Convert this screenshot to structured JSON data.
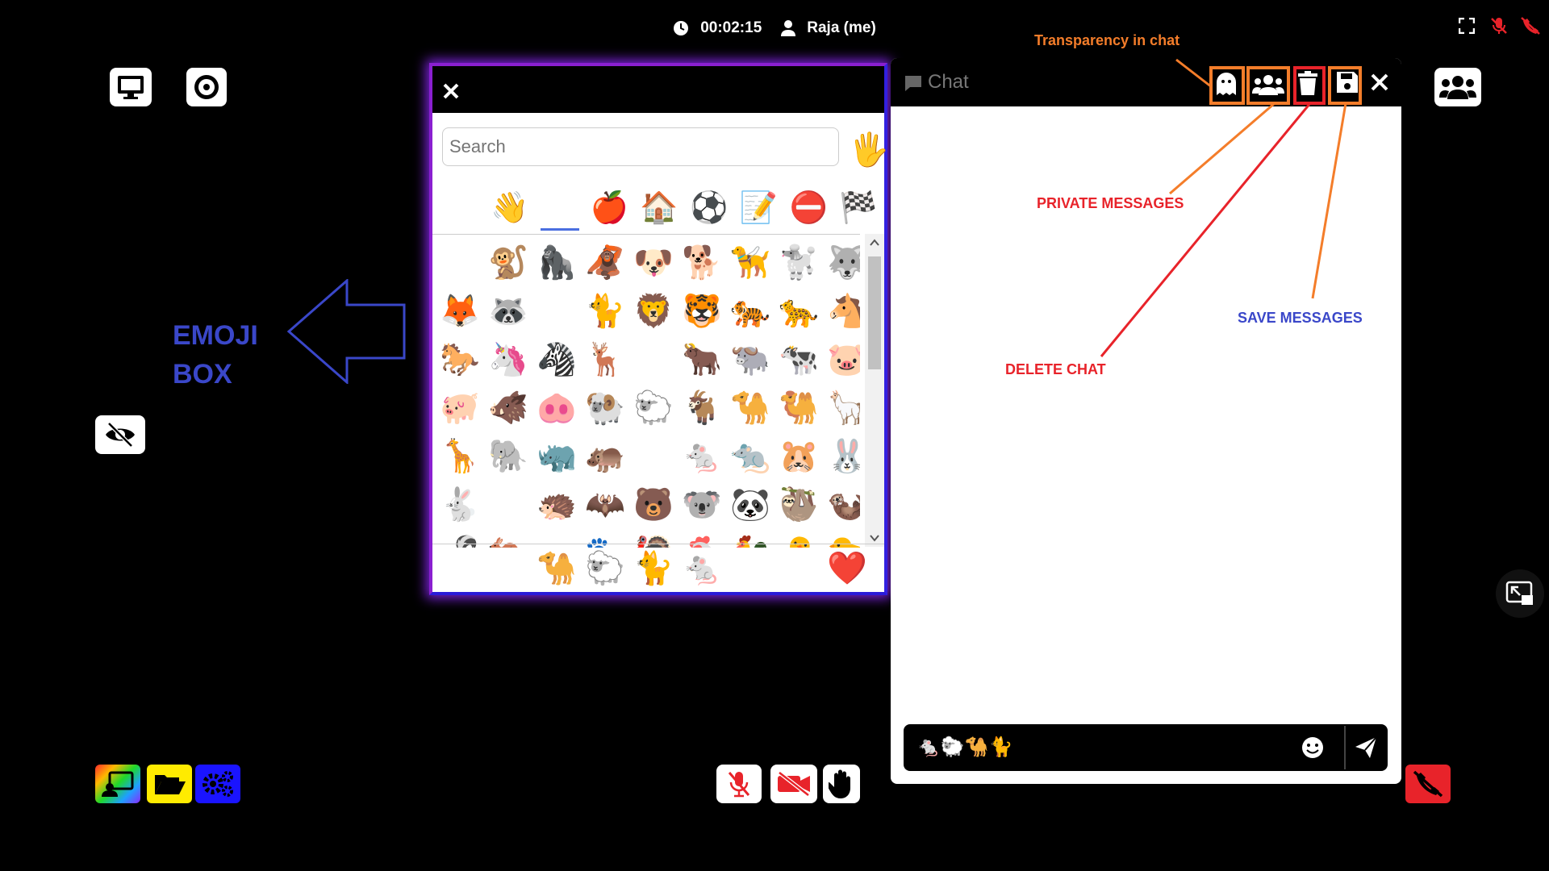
{
  "topbar": {
    "timer": "00:02:15",
    "user": "Raja (me)"
  },
  "left_controls": {
    "screen_icon": "monitor-icon",
    "record_icon": "record-icon",
    "camera_off_icon": "camera-off-icon"
  },
  "annotations": {
    "emoji_box_line1": "EMOJI",
    "emoji_box_line2": "BOX",
    "transparency": "Transparency in chat",
    "private": "PRIVATE MESSAGES",
    "delete": "DELETE CHAT",
    "save": "SAVE MESSAGES"
  },
  "emoji_panel": {
    "search_placeholder": "Search",
    "skin_tone_emoji": "🖐",
    "categories": [
      "😀",
      "👋",
      "🐱",
      "🍎",
      "🏠",
      "⚽",
      "📝",
      "⛔",
      "🏁"
    ],
    "active_category": 2,
    "grid": [
      "🐵",
      "🐒",
      "🦍",
      "🦧",
      "🐶",
      "🐕",
      "🦮",
      "🐩",
      "🐺",
      "🦊",
      "🦝",
      "🐱",
      "🐈",
      "🦁",
      "🐯",
      "🐅",
      "🐆",
      "🐴",
      "🐎",
      "🦄",
      "🦓",
      "🦌",
      "🐮",
      "🐂",
      "🐃",
      "🐄",
      "🐷",
      "🐖",
      "🐗",
      "🐽",
      "🐏",
      "🐑",
      "🐐",
      "🐪",
      "🐫",
      "🦙",
      "🦒",
      "🐘",
      "🦏",
      "🦛",
      "🐭",
      "🐁",
      "🐀",
      "🐹",
      "🐰",
      "🐇",
      "🐿",
      "🦔",
      "🦇",
      "🐻",
      "🐨",
      "🐼",
      "🦥",
      "🦦",
      "🦨",
      "🦘",
      "🦡",
      "🐾",
      "🦃",
      "🐔",
      "🐓",
      "🐣",
      "🐤"
    ],
    "recent": [
      "🐭",
      "😍",
      "🐪",
      "🐑",
      "🐈",
      "🐁",
      "😊",
      "😒",
      "❤️"
    ]
  },
  "chat": {
    "title": "Chat",
    "input_value": "🐁🐑🐪🐈",
    "header_icons": [
      "ghost-icon",
      "users-icon",
      "trash-icon",
      "save-icon",
      "close-icon"
    ]
  },
  "colors": {
    "annotation_orange": "#f47d2a",
    "annotation_red": "#e8232a",
    "annotation_blue": "#3a47c9",
    "panel_glow": "#7a22d8"
  }
}
